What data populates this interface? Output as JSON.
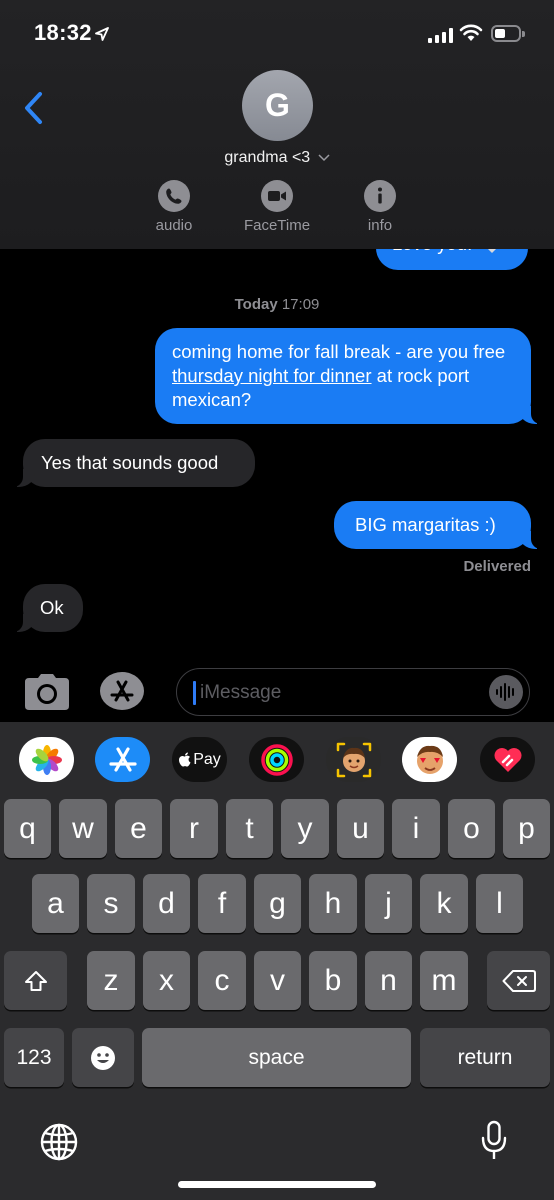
{
  "status_bar": {
    "time": "18:32"
  },
  "header": {
    "avatar_initial": "G",
    "contact_name": "grandma <3",
    "actions": {
      "audio": "audio",
      "facetime": "FaceTime",
      "info": "info"
    }
  },
  "thread": {
    "previous_message": "Love you!",
    "timestamp_day": "Today",
    "timestamp_time": "17:09",
    "msg1_prefix": "coming home for fall break - are you free ",
    "msg1_link": "thursday night for dinner",
    "msg1_suffix": " at rock port mexican?",
    "msg2": "Yes that sounds good",
    "msg3": "BIG margaritas :)",
    "delivered": "Delivered",
    "msg4": "Ok"
  },
  "input": {
    "placeholder": "iMessage"
  },
  "app_drawer": {
    "apple_pay": "Pay"
  },
  "keyboard": {
    "row1": [
      "q",
      "w",
      "e",
      "r",
      "t",
      "y",
      "u",
      "i",
      "o",
      "p"
    ],
    "row2": [
      "a",
      "s",
      "d",
      "f",
      "g",
      "h",
      "j",
      "k",
      "l"
    ],
    "row3": [
      "z",
      "x",
      "c",
      "v",
      "b",
      "n",
      "m"
    ],
    "numbers_key": "123",
    "space_key": "space",
    "return_key": "return"
  },
  "colors": {
    "bubble_outgoing": "#1a7cf4",
    "bubble_incoming": "#262629",
    "accent": "#2f7cf6",
    "background": "#000000"
  }
}
